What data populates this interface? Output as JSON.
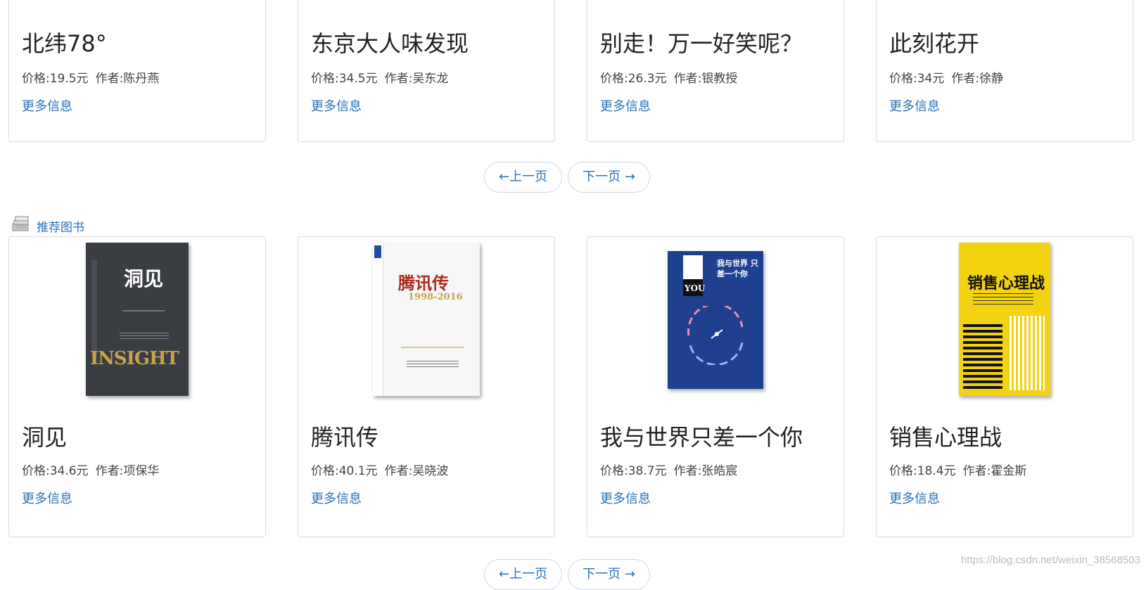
{
  "top_books": [
    {
      "title": "北纬78°",
      "price": "价格:19.5元",
      "author": "作者:陈丹燕",
      "more": "更多信息"
    },
    {
      "title": "东京大人味发现",
      "price": "价格:34.5元",
      "author": "作者:吴东龙",
      "more": "更多信息"
    },
    {
      "title": "别走！万一好笑呢？",
      "price": "价格:26.3元",
      "author": "作者:银教授",
      "more": "更多信息"
    },
    {
      "title": "此刻花开",
      "price": "价格:34元",
      "author": "作者:徐静",
      "more": "更多信息"
    }
  ],
  "pager": {
    "prev": "←上一页",
    "next": "下一页 →"
  },
  "section": {
    "label": "推荐图书",
    "icon": "books-stack-icon"
  },
  "recommended_books": [
    {
      "title": "洞见",
      "price": "价格:34.6元",
      "author": "作者:项保华",
      "more": "更多信息",
      "cover": {
        "main": "洞见",
        "sub": "INSIGHT",
        "bg": "#3a3d42",
        "fg": "#ffffff",
        "accent": "#c9a24a"
      }
    },
    {
      "title": "腾讯传",
      "price": "价格:40.1元",
      "author": "作者:吴晓波",
      "more": "更多信息",
      "cover": {
        "main": "腾讯传",
        "sub": "1998-2016",
        "bg": "#f7f7f7",
        "fg": "#b02a1a",
        "accent": "#1e4f9a"
      }
    },
    {
      "title": "我与世界只差一个你",
      "price": "价格:38.7元",
      "author": "作者:张皓宸",
      "more": "更多信息",
      "cover": {
        "main": "我与世界 只差一个你",
        "sub": "YOU",
        "bg": "#1f3f8f",
        "fg": "#ffffff",
        "accent": "#e88fb5"
      }
    },
    {
      "title": "销售心理战",
      "price": "价格:18.4元",
      "author": "作者:霍金斯",
      "more": "更多信息",
      "cover": {
        "main": "销售心理战",
        "sub": "",
        "bg": "#f3d20f",
        "fg": "#111111",
        "accent": "#111111"
      }
    }
  ],
  "watermark": "https://blog.csdn.net/weixin_38568503",
  "colors": {
    "link": "#2a72b5",
    "border": "#dcdcdc",
    "text": "#333333"
  }
}
